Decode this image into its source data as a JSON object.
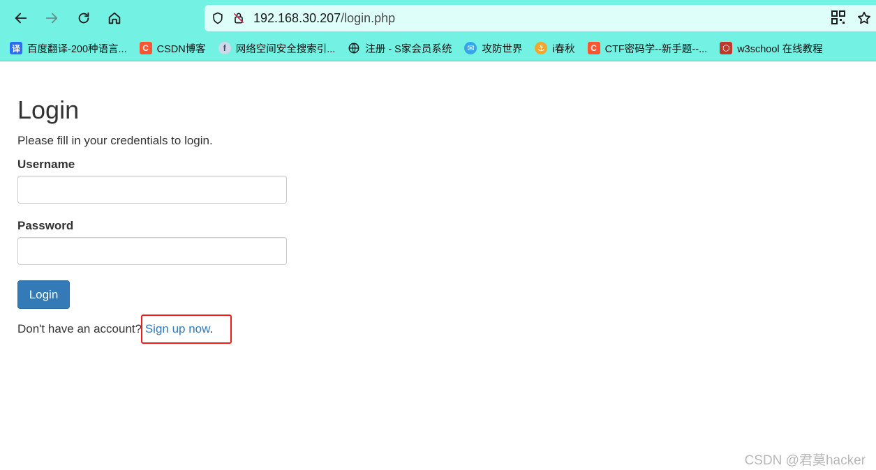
{
  "browser": {
    "url_host": "192.168.30.207",
    "url_path": "/login.php",
    "bookmarks": [
      {
        "label": "百度翻译-200种语言...",
        "icon": "baidu-translate-icon",
        "color": "#2a6cf2",
        "glyph": "译"
      },
      {
        "label": "CSDN博客",
        "icon": "csdn-icon",
        "color": "#fc5531",
        "glyph": "C"
      },
      {
        "label": "网络空间安全搜索引...",
        "icon": "fofa-icon",
        "color": "#cfd8e6",
        "glyph": "f"
      },
      {
        "label": "注册 - S家会员系统",
        "icon": "globe-icon",
        "color": "",
        "glyph": ""
      },
      {
        "label": "攻防世界",
        "icon": "adworld-icon",
        "color": "#37a3e8",
        "glyph": "✉"
      },
      {
        "label": "i春秋",
        "icon": "ichunqiu-icon",
        "color": "#f3a62b",
        "glyph": "⚓"
      },
      {
        "label": "CTF密码学--新手题--...",
        "icon": "csdn-icon",
        "color": "#fc5531",
        "glyph": "C"
      },
      {
        "label": "w3school 在线教程",
        "icon": "w3school-icon",
        "color": "#c0392b",
        "glyph": "⬡"
      }
    ]
  },
  "page": {
    "title": "Login",
    "subtitle": "Please fill in your credentials to login.",
    "username_label": "Username",
    "username_value": "",
    "password_label": "Password",
    "password_value": "",
    "login_button": "Login",
    "signup_prompt": "Don't have an account? ",
    "signup_link": "Sign up now",
    "signup_suffix": "."
  },
  "watermark": "CSDN @君莫hacker",
  "colors": {
    "chrome": "#73f2e4",
    "primary": "#337ab7",
    "highlight": "#f21a1a"
  }
}
